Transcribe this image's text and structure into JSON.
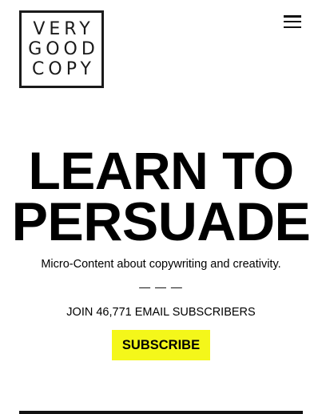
{
  "logo": {
    "lines": [
      "VERY",
      "GOOD",
      "COPY"
    ]
  },
  "header": {
    "menu_icon": "hamburger-menu-icon"
  },
  "hero": {
    "title_line1": "LEARN TO",
    "title_line2": "PERSUADE",
    "subtitle": "Micro-Content about copywriting and creativity.",
    "divider": "— — —",
    "join_text": "JOIN 46,771 EMAIL SUBSCRIBERS",
    "subscribe_label": "SUBSCRIBE"
  },
  "colors": {
    "accent": "#f4f71a",
    "text": "#000000",
    "background": "#ffffff"
  }
}
